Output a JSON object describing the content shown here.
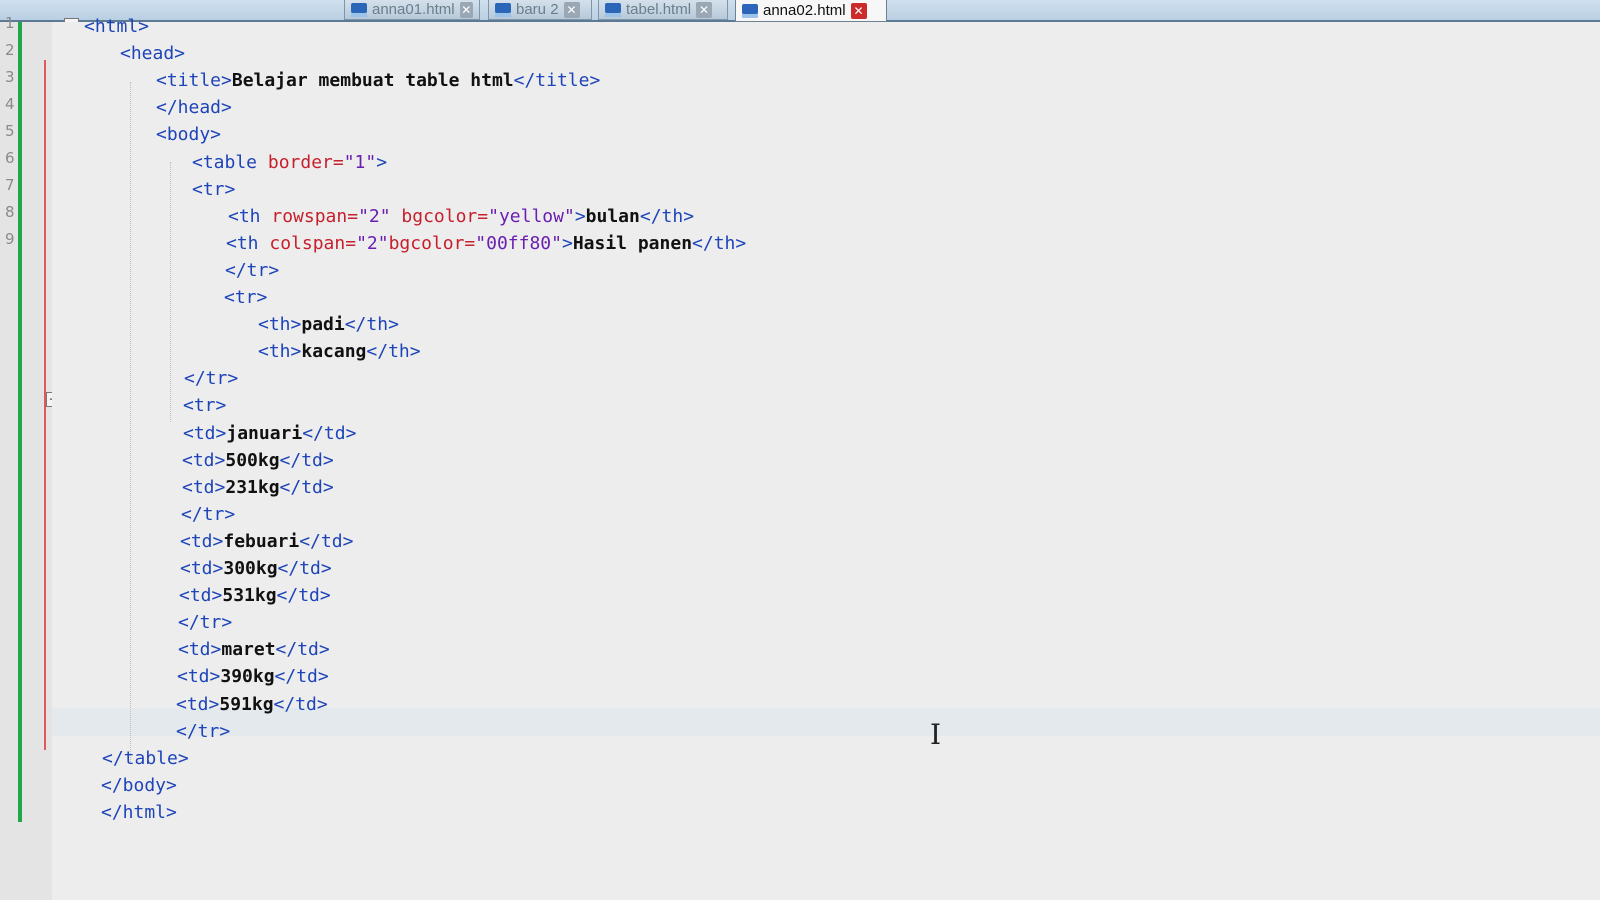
{
  "tabs": [
    {
      "label": "anna01.html",
      "close": "✕"
    },
    {
      "label": "baru 2",
      "close": "✕"
    },
    {
      "label": "tabel.html",
      "close": "✕"
    },
    {
      "label": "anna02.html",
      "close": "✕",
      "active": true
    }
  ],
  "line_numbers": [
    "1",
    "2",
    "3",
    "4",
    "5",
    "6",
    "7",
    "8",
    "9"
  ],
  "code_lines": [
    {
      "indent": 0,
      "parts": [
        [
          "tg",
          "<html>"
        ]
      ]
    },
    {
      "indent": 1,
      "parts": [
        [
          "tg",
          "<head>"
        ]
      ]
    },
    {
      "indent": 2,
      "parts": [
        [
          "tg",
          "<title>"
        ],
        [
          "tx",
          "Belajar membuat table html"
        ],
        [
          "tg",
          "</title>"
        ]
      ]
    },
    {
      "indent": 2,
      "parts": [
        [
          "tg",
          "</head>"
        ]
      ]
    },
    {
      "indent": 2,
      "parts": [
        [
          "tg",
          "<body>"
        ]
      ]
    },
    {
      "indent": 3,
      "parts": [
        [
          "tg",
          "<table "
        ],
        [
          "at",
          "border="
        ],
        [
          "st",
          "\"1\""
        ],
        [
          "tg",
          ">"
        ]
      ]
    },
    {
      "indent": 3,
      "parts": [
        [
          "tg",
          "<tr>"
        ]
      ]
    },
    {
      "indent": 4,
      "parts": [
        [
          "tg",
          "<th "
        ],
        [
          "at",
          "rowspan="
        ],
        [
          "st",
          "\"2\""
        ],
        [
          "at",
          " bgcolor="
        ],
        [
          "st",
          "\"yellow\""
        ],
        [
          "tg",
          ">"
        ],
        [
          "tx",
          "bulan"
        ],
        [
          "tg",
          "</th>"
        ]
      ]
    },
    {
      "indent": 4,
      "parts": [
        [
          "tg",
          "<th "
        ],
        [
          "at",
          "colspan="
        ],
        [
          "st",
          "\"2\""
        ],
        [
          "at",
          "bgcolor="
        ],
        [
          "st",
          "\"00ff80\""
        ],
        [
          "tg",
          ">"
        ],
        [
          "tx",
          "Hasil panen"
        ],
        [
          "tg",
          "</th>"
        ]
      ]
    },
    {
      "indent": 4,
      "parts": [
        [
          "tg",
          "</tr>"
        ]
      ]
    },
    {
      "indent": 4,
      "parts": [
        [
          "tg",
          "<tr>"
        ]
      ]
    },
    {
      "indent": 5,
      "parts": [
        [
          "tg",
          "<th>"
        ],
        [
          "tx",
          "padi"
        ],
        [
          "tg",
          "</th>"
        ]
      ]
    },
    {
      "indent": 5,
      "parts": [
        [
          "tg",
          "<th>"
        ],
        [
          "tx",
          "kacang"
        ],
        [
          "tg",
          "</th>"
        ]
      ]
    },
    {
      "indent": 3,
      "parts": [
        [
          "tg",
          "</tr>"
        ]
      ]
    },
    {
      "indent": 3,
      "parts": [
        [
          "tg",
          "<tr>"
        ]
      ]
    },
    {
      "indent": 3,
      "parts": [
        [
          "tg",
          "<td>"
        ],
        [
          "tx",
          "januari"
        ],
        [
          "tg",
          "</td>"
        ]
      ]
    },
    {
      "indent": 3,
      "parts": [
        [
          "tg",
          "<td>"
        ],
        [
          "tx",
          "500kg"
        ],
        [
          "tg",
          "</td>"
        ]
      ]
    },
    {
      "indent": 3,
      "parts": [
        [
          "tg",
          "<td>"
        ],
        [
          "tx",
          "231kg"
        ],
        [
          "tg",
          "</td>"
        ]
      ]
    },
    {
      "indent": 3,
      "parts": [
        [
          "tg",
          "</tr>"
        ]
      ]
    },
    {
      "indent": 3,
      "parts": [
        [
          "tg",
          "<td>"
        ],
        [
          "tx",
          "febuari"
        ],
        [
          "tg",
          "</td>"
        ]
      ]
    },
    {
      "indent": 3,
      "parts": [
        [
          "tg",
          "<td>"
        ],
        [
          "tx",
          "300kg"
        ],
        [
          "tg",
          "</td>"
        ]
      ]
    },
    {
      "indent": 3,
      "parts": [
        [
          "tg",
          "<td>"
        ],
        [
          "tx",
          "531kg"
        ],
        [
          "tg",
          "</td>"
        ]
      ]
    },
    {
      "indent": 3,
      "parts": [
        [
          "tg",
          "</tr>"
        ]
      ]
    },
    {
      "indent": 3,
      "parts": [
        [
          "tg",
          "<td>"
        ],
        [
          "tx",
          "maret"
        ],
        [
          "tg",
          "</td>"
        ]
      ]
    },
    {
      "indent": 3,
      "parts": [
        [
          "tg",
          "<td>"
        ],
        [
          "tx",
          "390kg"
        ],
        [
          "tg",
          "</td>"
        ]
      ]
    },
    {
      "indent": 3,
      "parts": [
        [
          "tg",
          "<td>"
        ],
        [
          "tx",
          "591kg"
        ],
        [
          "tg",
          "</td>"
        ]
      ]
    },
    {
      "indent": 3,
      "parts": [
        [
          "tg",
          "</tr>"
        ]
      ]
    },
    {
      "indent": 1,
      "parts": [
        [
          "tg",
          "</table>"
        ]
      ]
    },
    {
      "indent": 1,
      "parts": [
        [
          "tg",
          "</body>"
        ]
      ]
    },
    {
      "indent": 1,
      "parts": [
        [
          "tg",
          "</html>"
        ]
      ]
    }
  ],
  "caret_glyph": "I"
}
